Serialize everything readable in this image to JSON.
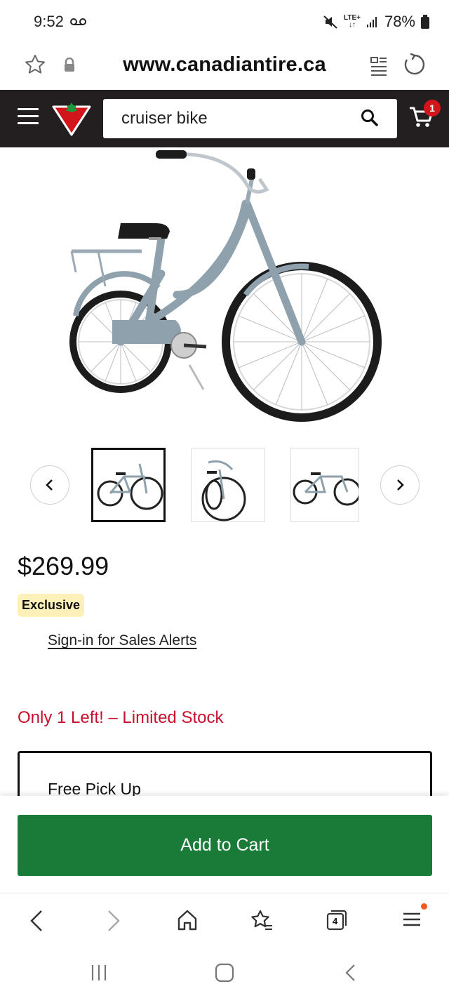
{
  "status": {
    "time": "9:52",
    "battery": "78%",
    "network_top": "LTE+",
    "network_bottom": "↓↑"
  },
  "browser": {
    "url": "www.canadiantire.ca"
  },
  "header": {
    "search_value": "cruiser bike",
    "cart_count": "1"
  },
  "product": {
    "price": "$269.99",
    "badge": "Exclusive",
    "signin_link": "Sign-in for Sales Alerts",
    "stock_warning": "Only 1 Left! – Limited Stock",
    "fulfilment_title": "Free Pick Up",
    "add_to_cart": "Add to Cart",
    "frame_color": "#8ea1ad"
  },
  "browser_nav": {
    "tab_count": "4"
  },
  "colors": {
    "brand_red": "#d2151b",
    "header_bg": "#231f20",
    "cta_green": "#1a7a38",
    "stock_red": "#c8102e",
    "exclusive_bg": "#fdf0b8"
  }
}
